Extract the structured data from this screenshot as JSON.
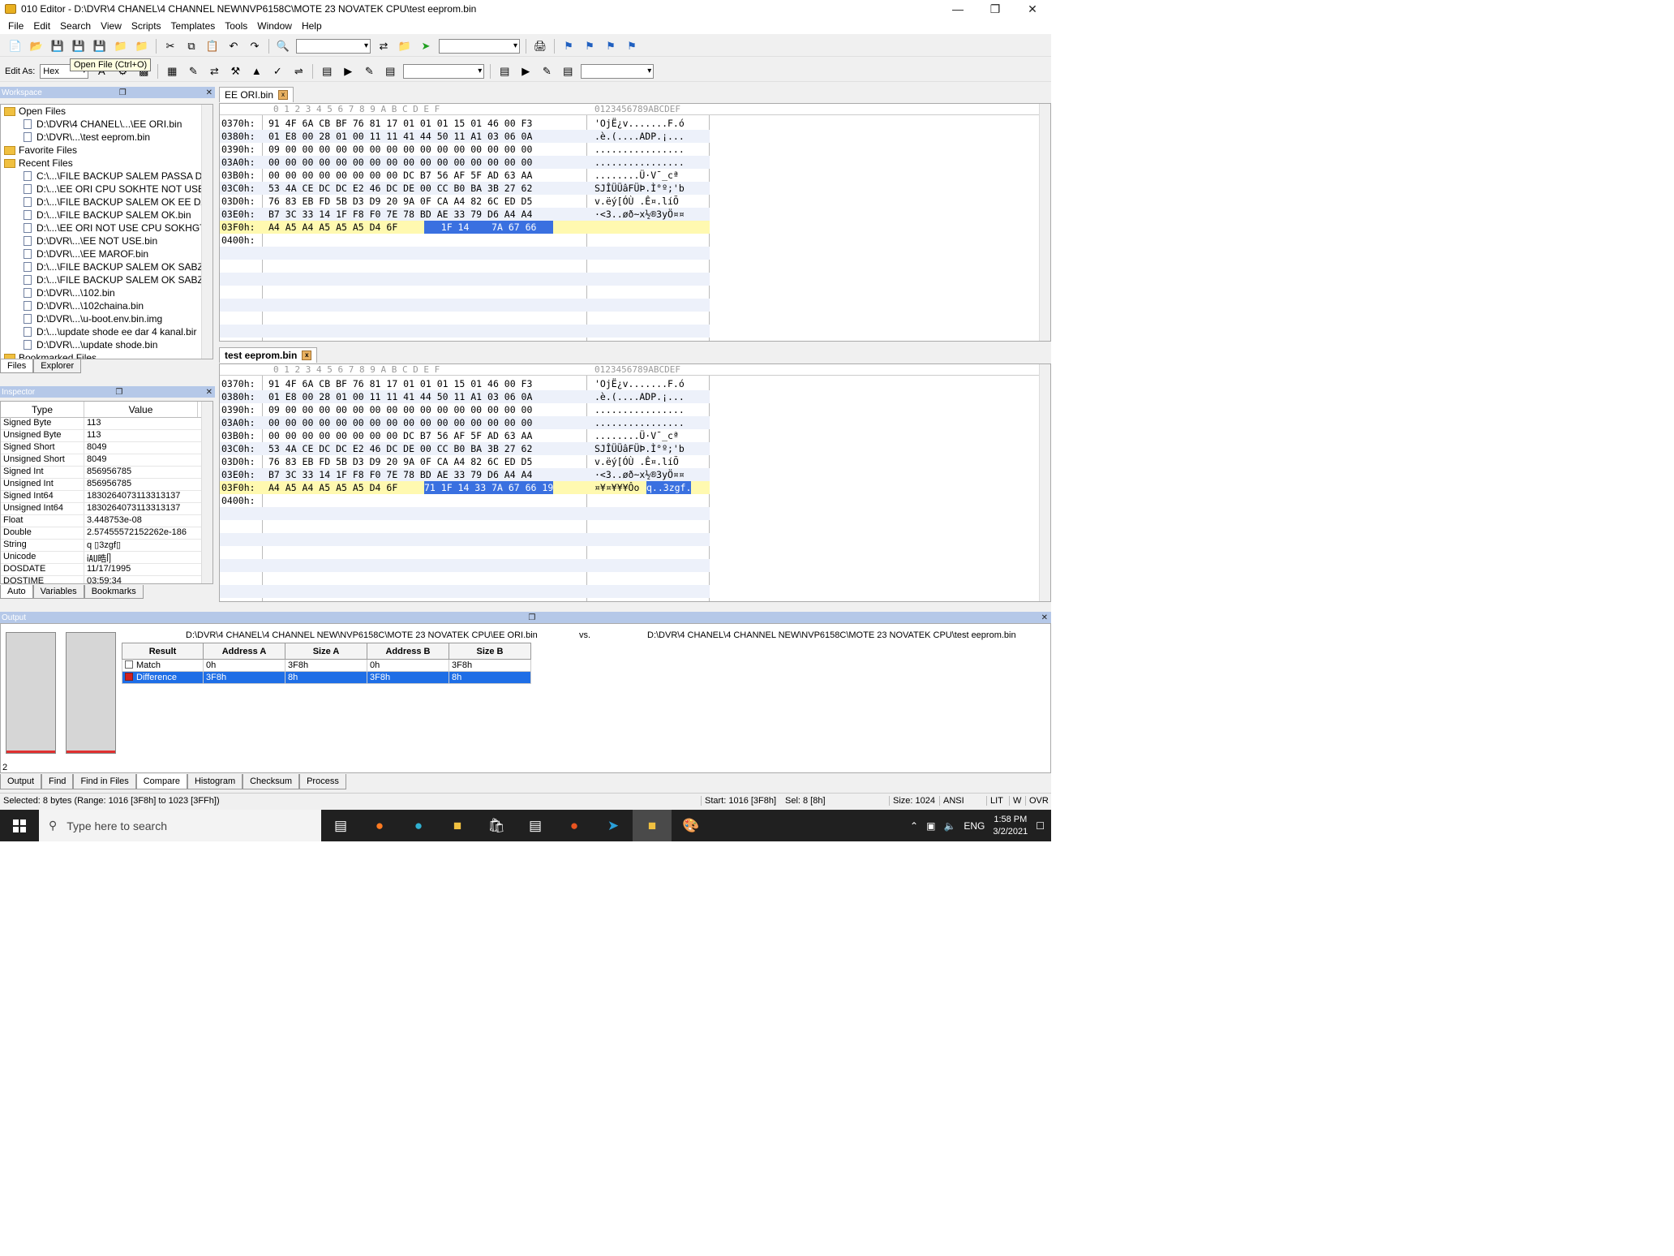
{
  "window": {
    "title": "010 Editor - D:\\DVR\\4 CHANEL\\4 CHANNEL NEW\\NVP6158C\\MOTE 23 NOVATEK CPU\\test eeprom.bin"
  },
  "menu": [
    "File",
    "Edit",
    "Search",
    "View",
    "Scripts",
    "Templates",
    "Tools",
    "Window",
    "Help"
  ],
  "toolbar": {
    "edit_as_label": "Edit As:",
    "edit_as_value": "Hex",
    "tooltip": "Open File (Ctrl+O)"
  },
  "workspace": {
    "title": "Workspace",
    "open_files_label": "Open Files",
    "open_files": [
      "D:\\DVR\\4 CHANEL\\...\\EE ORI.bin",
      "D:\\DVR\\...\\test eeprom.bin"
    ],
    "favorite_files_label": "Favorite Files",
    "recent_files_label": "Recent Files",
    "recent_files": [
      "C:\\...\\FILE BACKUP SALEM PASSA DA",
      "D:\\...\\EE ORI CPU SOKHTE NOT USE.b",
      "D:\\...\\FILE BACKUP SALEM OK EE DAI",
      "D:\\...\\FILE BACKUP SALEM OK.bin",
      "D:\\...\\EE ORI NOT USE CPU SOKHGTE",
      "D:\\DVR\\...\\EE NOT USE.bin",
      "D:\\DVR\\...\\EE MAROF.bin",
      "D:\\...\\FILE BACKUP SALEM OK SABZ I",
      "D:\\...\\FILE BACKUP SALEM OK SABZ I",
      "D:\\DVR\\...\\102.bin",
      "D:\\DVR\\...\\102chaina.bin",
      "D:\\DVR\\...\\u-boot.env.bin.img",
      "D:\\...\\update shode ee dar 4 kanal.bir",
      "D:\\DVR\\...\\update shode.bin"
    ],
    "bookmarked_label": "Bookmarked Files",
    "tabs": [
      "Files",
      "Explorer"
    ]
  },
  "inspector": {
    "title": "Inspector",
    "col_type": "Type",
    "col_value": "Value",
    "rows": [
      {
        "type": "Signed Byte",
        "value": "113"
      },
      {
        "type": "Unsigned Byte",
        "value": "113"
      },
      {
        "type": "Signed Short",
        "value": "8049"
      },
      {
        "type": "Unsigned Short",
        "value": "8049"
      },
      {
        "type": "Signed Int",
        "value": "856956785"
      },
      {
        "type": "Unsigned Int",
        "value": "856956785"
      },
      {
        "type": "Signed Int64",
        "value": "1830264073113313137"
      },
      {
        "type": "Unsigned Int64",
        "value": "1830264073113313137"
      },
      {
        "type": "Float",
        "value": "3.448753e-08"
      },
      {
        "type": "Double",
        "value": "2.57455572152262e-186"
      },
      {
        "type": "String",
        "value": "q ▯3zgf▯"
      },
      {
        "type": "Unicode",
        "value": "ἱ㍳晧ᥦ"
      },
      {
        "type": "DOSDATE",
        "value": "11/17/1995"
      },
      {
        "type": "DOSTIME",
        "value": "03:59:34"
      }
    ],
    "tabs": [
      "Auto",
      "Variables",
      "Bookmarks"
    ]
  },
  "editor1": {
    "tab": "EE ORI.bin",
    "ruler_hex": "0  1  2  3  4  5  6  7  8  9  A  B  C  D  E  F",
    "ruler_ascii": "0123456789ABCDEF",
    "lines": [
      {
        "addr": "0370h:",
        "hex": "91 4F 6A CB BF 76 81 17 01 01 01 15 01 46 00 F3",
        "ascii": "'OjË¿v.......F.ó"
      },
      {
        "addr": "0380h:",
        "hex": "01 E8 00 28 01 00 11 11 41 44 50 11 A1 03 06 0A",
        "ascii": ".è.(....ADP.¡..."
      },
      {
        "addr": "0390h:",
        "hex": "09 00 00 00 00 00 00 00 00 00 00 00 00 00 00 00",
        "ascii": "................"
      },
      {
        "addr": "03A0h:",
        "hex": "00 00 00 00 00 00 00 00 00 00 00 00 00 00 00 00",
        "ascii": "................"
      },
      {
        "addr": "03B0h:",
        "hex": "00 00 00 00 00 00 00 00 DC B7 56 AF 5F AD 63 AA",
        "ascii": "........Ü·V¯_­cª"
      },
      {
        "addr": "03C0h:",
        "hex": "53 4A CE DC DC E2 46 DC DE 00 CC B0 BA 3B 27 62",
        "ascii": "SJÎÜÜâFÜÞ.Ì°º;'b"
      },
      {
        "addr": "03D0h:",
        "hex": "76 83 EB FD 5B D3 D9 20 9A 0F CA A4 82 6C ED D5",
        "ascii": "v.ëý[ÓÙ .Ê¤.líÕ"
      },
      {
        "addr": "03E0h:",
        "hex": "B7 3C 33 14 1F F8 F0 7E 78 BD AE 33 79 D6 A4 A4",
        "ascii": "·<3..øð~x½®3yÖ¤¤"
      },
      {
        "addr": "03F0h:",
        "hex_a": "A4 A5 A4 A5 A5 A5 D4 6F ",
        "hex_b": "   1F 14    7A 67 66   ",
        "ascii": ""
      },
      {
        "addr": "0400h:",
        "hex": "",
        "ascii": ""
      }
    ]
  },
  "editor2": {
    "tab": "test eeprom.bin",
    "lines": [
      {
        "addr": "0370h:",
        "hex": "91 4F 6A CB BF 76 81 17 01 01 01 15 01 46 00 F3",
        "ascii": "'OjË¿v.......F.ó"
      },
      {
        "addr": "0380h:",
        "hex": "01 E8 00 28 01 00 11 11 41 44 50 11 A1 03 06 0A",
        "ascii": ".è.(....ADP.¡..."
      },
      {
        "addr": "0390h:",
        "hex": "09 00 00 00 00 00 00 00 00 00 00 00 00 00 00 00",
        "ascii": "................"
      },
      {
        "addr": "03A0h:",
        "hex": "00 00 00 00 00 00 00 00 00 00 00 00 00 00 00 00",
        "ascii": "................"
      },
      {
        "addr": "03B0h:",
        "hex": "00 00 00 00 00 00 00 00 DC B7 56 AF 5F AD 63 AA",
        "ascii": "........Ü·V¯_­cª"
      },
      {
        "addr": "03C0h:",
        "hex": "53 4A CE DC DC E2 46 DC DE 00 CC B0 BA 3B 27 62",
        "ascii": "SJÎÜÜâFÜÞ.Ì°º;'b"
      },
      {
        "addr": "03D0h:",
        "hex": "76 83 EB FD 5B D3 D9 20 9A 0F CA A4 82 6C ED D5",
        "ascii": "v.ëý[ÓÙ .Ê¤.líÕ"
      },
      {
        "addr": "03E0h:",
        "hex": "B7 3C 33 14 1F F8 F0 7E 78 BD AE 33 79 D6 A4 A4",
        "ascii": "·<3..øð~x½®3yÖ¤¤"
      },
      {
        "addr": "03F0h:",
        "hex_a": "A4 A5 A4 A5 A5 A5 D4 6F ",
        "hex_b": "71 1F 14 33 7A 67 66 19",
        "ascii_a": "¤¥¤¥¥¥Ôo",
        "ascii_b": "q..3zgf."
      },
      {
        "addr": "0400h:",
        "hex": "",
        "ascii": ""
      }
    ]
  },
  "output": {
    "title": "Output",
    "file_a": "D:\\DVR\\4 CHANEL\\4 CHANNEL NEW\\NVP6158C\\MOTE 23 NOVATEK CPU\\EE ORI.bin",
    "vs": "vs.",
    "file_b": "D:\\DVR\\4 CHANEL\\4 CHANNEL NEW\\NVP6158C\\MOTE 23 NOVATEK CPU\\test eeprom.bin",
    "columns": [
      "Result",
      "Address A",
      "Size A",
      "Address B",
      "Size B"
    ],
    "rows": [
      {
        "result": "Match",
        "addr_a": "0h",
        "size_a": "3F8h",
        "addr_b": "0h",
        "size_b": "3F8h"
      },
      {
        "result": "Difference",
        "addr_a": "3F8h",
        "size_a": "8h",
        "addr_b": "3F8h",
        "size_b": "8h"
      }
    ],
    "count": "2",
    "tabs": [
      "Output",
      "Find",
      "Find in Files",
      "Compare",
      "Histogram",
      "Checksum",
      "Process"
    ]
  },
  "status": {
    "selected": "Selected: 8 bytes (Range: 1016 [3F8h] to 1023 [3FFh])",
    "start": "Start: 1016 [3F8h]",
    "sel": "Sel: 8 [8h]",
    "size": "Size: 1024",
    "encoding": "ANSI",
    "lit": "LIT",
    "w": "W",
    "ovr": "OVR"
  },
  "taskbar": {
    "search_placeholder": "Type here to search",
    "lang": "ENG",
    "time": "1:58 PM",
    "date": "3/2/2021"
  }
}
